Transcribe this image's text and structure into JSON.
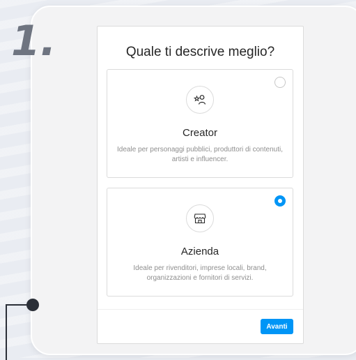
{
  "step": {
    "number": "1."
  },
  "dialog": {
    "title": "Quale ti descrive meglio?",
    "options": [
      {
        "title": "Creator",
        "description": "Ideale per personaggi pubblici, produttori di contenuti, artisti e influencer.",
        "icon": "creator-icon",
        "selected": false
      },
      {
        "title": "Azienda",
        "description": "Ideale per rivenditori, imprese locali, brand, organizzazioni e fornitori di servizi.",
        "icon": "shop-icon",
        "selected": true
      }
    ],
    "next_label": "Avanti"
  },
  "colors": {
    "accent": "#0095f6",
    "frame_bg": "#f3f3f4",
    "text": "#262626",
    "muted": "#8e8e8e"
  }
}
